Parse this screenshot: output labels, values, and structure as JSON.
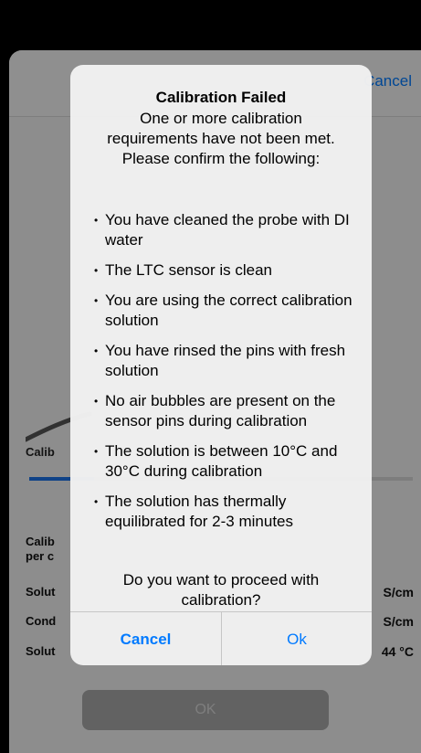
{
  "background": {
    "header_cancel": "Cancel",
    "calib_label": "Calib",
    "progress_fraction": 0.17,
    "rows": [
      {
        "label": "Calib\nper c",
        "value": ""
      },
      {
        "label": "Solut",
        "value": "S/cm"
      },
      {
        "label": "Cond",
        "value": "S/cm"
      },
      {
        "label": "Solut",
        "value": "44 °C"
      }
    ],
    "proceed_label": "OK"
  },
  "alert": {
    "title": "Calibration Failed",
    "message": "One or more calibration requirements have not been met.\nPlease confirm the following:",
    "bullets": [
      "You have cleaned the probe with DI water",
      "The LTC sensor is clean",
      "You are using the correct calibration solution",
      "You have rinsed the pins with fresh solution",
      "No air bubbles are present on the sensor pins during calibration",
      "The solution is between 10°C and 30°C during calibration",
      "The solution has thermally equilibrated for 2-3 minutes"
    ],
    "question": "Do you want to proceed with calibration?",
    "cancel_label": "Cancel",
    "ok_label": "Ok"
  },
  "colors": {
    "accent": "#007aff",
    "progress": "#1a73e8"
  }
}
